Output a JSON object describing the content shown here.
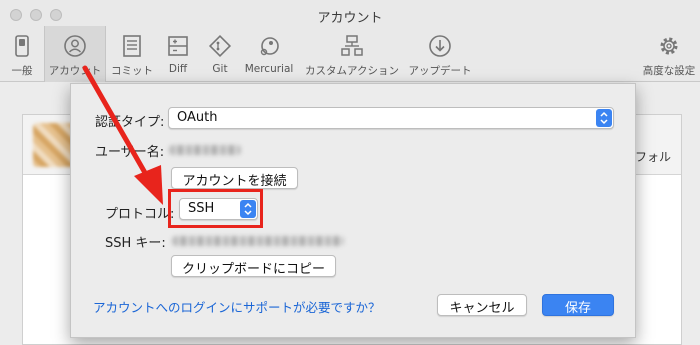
{
  "window": {
    "title": "アカウント"
  },
  "toolbar": {
    "items": [
      {
        "label": "一般"
      },
      {
        "label": "アカウント"
      },
      {
        "label": "コミット"
      },
      {
        "label": "Diff"
      },
      {
        "label": "Git"
      },
      {
        "label": "Mercurial"
      },
      {
        "label": "カスタムアクション"
      },
      {
        "label": "アップデート"
      },
      {
        "label": "高度な設定"
      }
    ],
    "selected": "アカウント"
  },
  "background": {
    "column_text": "フォル"
  },
  "dialog": {
    "auth_type_label": "認証タイプ:",
    "auth_type_value": "OAuth",
    "username_label": "ユーザー名:",
    "connect_button": "アカウントを接続",
    "protocol_label": "プロトコル:",
    "protocol_value": "SSH",
    "ssh_key_label": "SSH キー:",
    "copy_button": "クリップボードにコピー",
    "help_link": "アカウントへのログインにサポートが必要ですか？",
    "cancel_button": "キャンセル",
    "save_button": "保存"
  },
  "colors": {
    "accent": "#3b84f2",
    "highlight": "#e8241c",
    "link": "#1b66d6"
  },
  "icons": {
    "traffic_lights": [
      "close-button",
      "minimize-button",
      "zoom-button"
    ],
    "toolbar": [
      "switch-icon",
      "person-icon",
      "document-icon",
      "diff-icon",
      "git-icon",
      "mercurial-icon",
      "custom-action-icon",
      "download-icon",
      "gear-icon"
    ],
    "annotation": [
      "red-arrow",
      "red-highlight-box"
    ]
  }
}
